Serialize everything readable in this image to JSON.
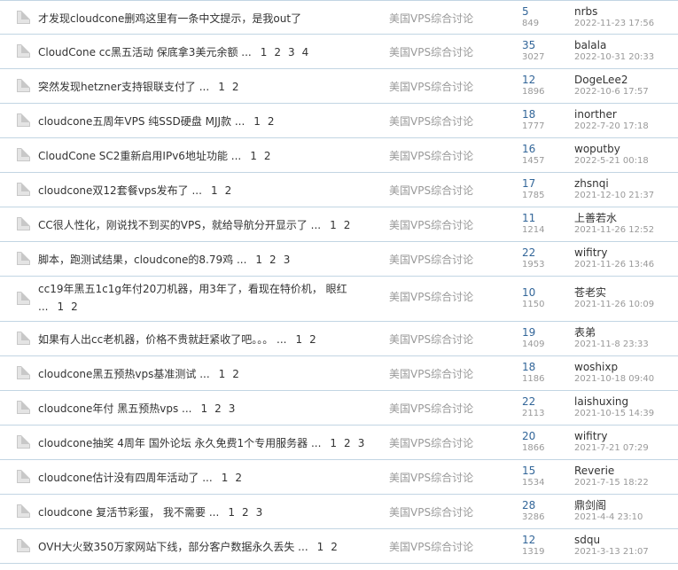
{
  "threads": [
    {
      "title": "才发现cloudcone删鸡这里有一条中文提示，是我out了",
      "pages": [],
      "forum": "美国VPS综合讨论",
      "replies": "5",
      "views": "849",
      "author": "nrbs",
      "date": "2022-11-23 17:56"
    },
    {
      "title": "CloudCone cc黑五活动 保底拿3美元余额 ...",
      "pages": [
        "1",
        "2",
        "3",
        "4"
      ],
      "forum": "美国VPS综合讨论",
      "replies": "35",
      "views": "3027",
      "author": "balala",
      "date": "2022-10-31 20:33"
    },
    {
      "title": "突然发现hetzner支持银联支付了 ...",
      "pages": [
        "1",
        "2"
      ],
      "forum": "美国VPS综合讨论",
      "replies": "12",
      "views": "1896",
      "author": "DogeLee2",
      "date": "2022-10-6 17:57"
    },
    {
      "title": "cloudcone五周年VPS 纯SSD硬盘 MJJ款 ...",
      "pages": [
        "1",
        "2"
      ],
      "forum": "美国VPS综合讨论",
      "replies": "18",
      "views": "1777",
      "author": "inorther",
      "date": "2022-7-20 17:18"
    },
    {
      "title": "CloudCone SC2重新启用IPv6地址功能 ...",
      "pages": [
        "1",
        "2"
      ],
      "forum": "美国VPS综合讨论",
      "replies": "16",
      "views": "1457",
      "author": "woputby",
      "date": "2022-5-21 00:18"
    },
    {
      "title": "cloudcone双12套餐vps发布了 ...",
      "pages": [
        "1",
        "2"
      ],
      "forum": "美国VPS综合讨论",
      "replies": "17",
      "views": "1785",
      "author": "zhsnqi",
      "date": "2021-12-10 21:37"
    },
    {
      "title": "CC很人性化，刚说找不到买的VPS，就给导航分开显示了 ...",
      "pages": [
        "1",
        "2"
      ],
      "forum": "美国VPS综合讨论",
      "replies": "11",
      "views": "1214",
      "author": "上善若水",
      "date": "2021-11-26 12:52"
    },
    {
      "title": "脚本，跑测试结果，cloudcone的8.79鸡 ...",
      "pages": [
        "1",
        "2",
        "3"
      ],
      "forum": "美国VPS综合讨论",
      "replies": "22",
      "views": "1953",
      "author": "wifitry",
      "date": "2021-11-26 13:46"
    },
    {
      "title": "cc19年黑五1c1g年付20刀机器，用3年了，看现在特价机， 眼红 ...",
      "pages": [
        "1",
        "2"
      ],
      "forum": "美国VPS综合讨论",
      "replies": "10",
      "views": "1150",
      "author": "苍老实",
      "date": "2021-11-26 10:09",
      "tall": true
    },
    {
      "title": "如果有人出cc老机器，价格不贵就赶紧收了吧。。。 ...",
      "pages": [
        "1",
        "2"
      ],
      "forum": "美国VPS综合讨论",
      "replies": "19",
      "views": "1409",
      "author": "表弟",
      "date": "2021-11-8 23:33"
    },
    {
      "title": "cloudcone黑五预热vps基准测试 ...",
      "pages": [
        "1",
        "2"
      ],
      "forum": "美国VPS综合讨论",
      "replies": "18",
      "views": "1186",
      "author": "woshixp",
      "date": "2021-10-18 09:40"
    },
    {
      "title": "cloudcone年付 黑五预热vps ...",
      "pages": [
        "1",
        "2",
        "3"
      ],
      "forum": "美国VPS综合讨论",
      "replies": "22",
      "views": "2113",
      "author": "laishuxing",
      "date": "2021-10-15 14:39"
    },
    {
      "title": "cloudcone抽奖 4周年 国外论坛 永久免费1个专用服务器 ...",
      "pages": [
        "1",
        "2",
        "3"
      ],
      "forum": "美国VPS综合讨论",
      "replies": "20",
      "views": "1866",
      "author": "wifitry",
      "date": "2021-7-21 07:29"
    },
    {
      "title": "cloudcone估计没有四周年活动了 ...",
      "pages": [
        "1",
        "2"
      ],
      "forum": "美国VPS综合讨论",
      "replies": "15",
      "views": "1534",
      "author": "Reverie",
      "date": "2021-7-15 18:22"
    },
    {
      "title": "cloudcone 复活节彩蛋， 我不需要 ...",
      "pages": [
        "1",
        "2",
        "3"
      ],
      "forum": "美国VPS综合讨论",
      "replies": "28",
      "views": "3286",
      "author": "鼎剑阁",
      "date": "2021-4-4 23:10"
    },
    {
      "title": "OVH大火致350万家网站下线，部分客户数据永久丢失 ...",
      "pages": [
        "1",
        "2"
      ],
      "forum": "美国VPS综合讨论",
      "replies": "12",
      "views": "1319",
      "author": "sdqu",
      "date": "2021-3-13 21:07"
    }
  ]
}
